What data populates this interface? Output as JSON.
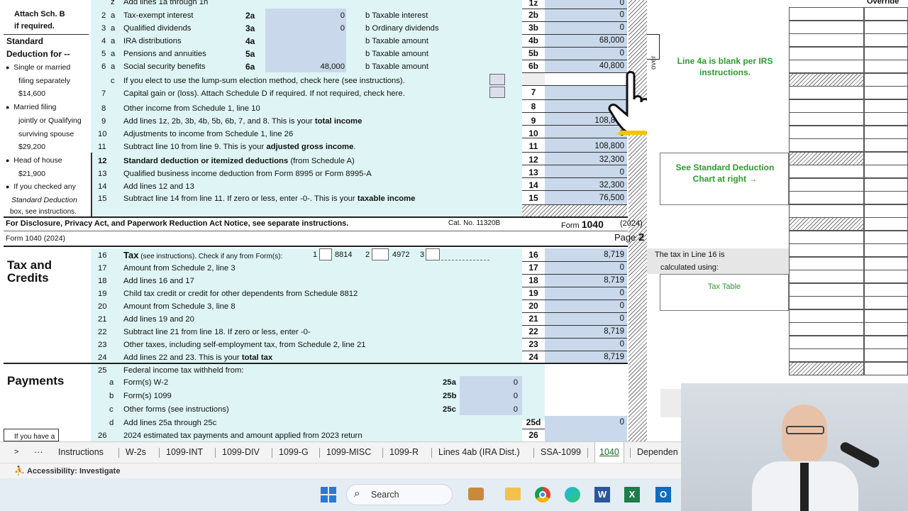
{
  "form": {
    "header_line": "Add lines 1a through 1h",
    "left_labels": {
      "attach": "Attach Sch. B",
      "if_required": "if required.",
      "std_title1": "Standard",
      "std_title2": "Deduction for --",
      "single": "Single or married",
      "filing_sep": "filing separately",
      "single_amt": "$14,600",
      "married": "Married filing",
      "jointly": "jointly or Qualifying",
      "surviving": "surviving spouse",
      "married_amt": "$29,200",
      "hoh": "Head of house",
      "hoh_amt": "$21,900",
      "checked": "If you checked any",
      "std_box": "Standard Deduction",
      "box_see": "box, see instructions."
    },
    "lines": [
      {
        "id": "2a",
        "n": "2",
        "sub": "a",
        "label": "Tax-exempt interest",
        "box": "2a",
        "box_val": "0",
        "b_label": "b  Taxable interest",
        "ln": "2b",
        "amt": "0"
      },
      {
        "id": "3a",
        "n": "3",
        "sub": "a",
        "label": "Qualified dividends",
        "box": "3a",
        "box_val": "0",
        "b_label": "b  Ordinary dividends",
        "ln": "3b",
        "amt": "0"
      },
      {
        "id": "4a",
        "n": "4",
        "sub": "a",
        "label": "IRA distributions",
        "box": "4a",
        "box_val": "",
        "b_label": "b  Taxable amount",
        "ln": "4b",
        "amt": "68,000"
      },
      {
        "id": "5a",
        "n": "5",
        "sub": "a",
        "label": "Pensions and annuities",
        "box": "5a",
        "box_val": "",
        "b_label": "b  Taxable amount",
        "ln": "5b",
        "amt": "0"
      },
      {
        "id": "6a",
        "n": "6",
        "sub": "a",
        "label": "Social security benefits",
        "box": "6a",
        "box_val": "48,000",
        "b_label": "b  Taxable amount",
        "ln": "6b",
        "amt": "40,800"
      }
    ],
    "line6c": "If you elect to use the lump-sum election method, check here (see instructions).",
    "line7": "Capital gain or (loss). Attach Schedule D if required. If not required, check here.",
    "line8": "Other income from Schedule 1, line 10",
    "line9_a": "Add lines 1z, 2b, 3b, 4b, 5b, 6b, 7, and 8. This is your ",
    "line9_b": "total income",
    "line9_amt": "108,800",
    "line10": "Adjustments to income from Schedule 1, line 26",
    "line10_amt": "0",
    "line11_a": "Subtract line 10 from line 9. This is your ",
    "line11_b": "adjusted gross income",
    "line11_amt": "108,800",
    "line12_a": "Standard deduction or itemized deductions",
    "line12_b": " (from Schedule A)",
    "line12_amt": "32,300",
    "line13": "Qualified business income deduction from Form 8995 or Form 8995-A",
    "line13_amt": "0",
    "line14": "Add lines 12 and 13",
    "line14_amt": "32,300",
    "line15_a": "Subtract line 14 from line 11.  If zero or less, enter -0-.   This is your ",
    "line15_b": "taxable income",
    "line15_amt": "76,500",
    "footer_notice": "For Disclosure, Privacy Act, and Paperwork Reduction Act Notice, see separate instructions.",
    "cat_no": "Cat. No. 11320B",
    "form_word": "Form",
    "form_num": "1040",
    "year": "(2024)",
    "page2_form": "Form 1040  (2024)",
    "page_word": "Page",
    "page_num": "2",
    "tax_credits_1": "Tax and",
    "tax_credits_2": "Credits",
    "payments": "Payments",
    "if_you_have": "If you have a",
    "line16_label": "Tax",
    "line16_see": " (see instructions).  Check if any from Form(s):",
    "line16_f1n": "1",
    "line16_f1": "8814",
    "line16_f2n": "2",
    "line16_f2": "4972",
    "line16_f3n": "3",
    "line16_amt": "8,719",
    "p2_lines": [
      {
        "n": "17",
        "label": "Amount from Schedule 2, line 3",
        "ln": "17",
        "amt": "0"
      },
      {
        "n": "18",
        "label": "Add lines 16 and 17",
        "ln": "18",
        "amt": "8,719"
      },
      {
        "n": "19",
        "label": "Child tax credit or credit for other dependents from Schedule 8812",
        "ln": "19",
        "amt": "0"
      },
      {
        "n": "20",
        "label": "Amount from Schedule 3, line 8",
        "ln": "20",
        "amt": "0"
      },
      {
        "n": "21",
        "label": "Add lines 19 and 20",
        "ln": "21",
        "amt": "0"
      },
      {
        "n": "22",
        "label": "Subtract line 21 from line 18. If zero or less, enter -0-",
        "ln": "22",
        "amt": "8,719"
      },
      {
        "n": "23",
        "label": "Other taxes, including self-employment tax, from Schedule 2, line 21",
        "ln": "23",
        "amt": "0"
      }
    ],
    "line24_a": "Add lines 22 and 23. This is your ",
    "line24_b": "total tax",
    "line24_amt": "8,719",
    "line25": "Federal income tax withheld from:",
    "line25a": "Form(s) W-2",
    "line25b": "Form(s) 1099",
    "line25c": "Other forms (see instructions)",
    "line25d": "Add lines 25a through 25c",
    "line26": "2024 estimated tax payments and amount applied from 2023 return",
    "box25a": "0",
    "box25b": "0",
    "box25c": "0",
    "amt25d": "0"
  },
  "sidepanel": {
    "override": "Override",
    "note_4a": "Line 4a is blank per IRS instructions.",
    "std_chart": "See Standard Deduction Chart at right →",
    "tax_line16_1": "The tax in Line 16 is",
    "tax_line16_2": "calculated using:",
    "tax_table": "Tax Table",
    "vert_text": "over"
  },
  "tabs": {
    "items": [
      "Instructions",
      "W-2s",
      "1099-INT",
      "1099-DIV",
      "1099-G",
      "1099-MISC",
      "1099-R",
      "Lines 4ab (IRA Dist.)",
      "SSA-1099",
      "1040",
      "Dependen"
    ],
    "active": "1040",
    "more": "···",
    "next": ">"
  },
  "status": {
    "accessibility": "Accessibility: Investigate"
  },
  "taskbar": {
    "search": "Search"
  }
}
